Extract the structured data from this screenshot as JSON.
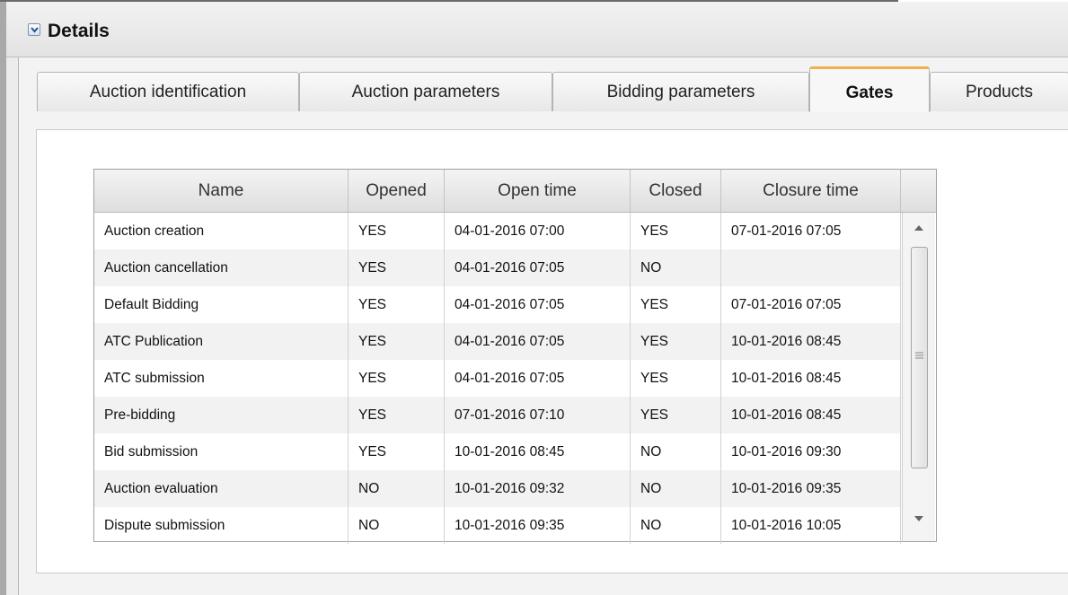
{
  "panel": {
    "title": "Details",
    "collapse_icon": "chevron-down-icon"
  },
  "tabs": [
    {
      "label": "Auction identification",
      "active": false
    },
    {
      "label": "Auction parameters",
      "active": false
    },
    {
      "label": "Bidding parameters",
      "active": false
    },
    {
      "label": "Gates",
      "active": true
    },
    {
      "label": "Products",
      "active": false
    }
  ],
  "table": {
    "columns": [
      "Name",
      "Opened",
      "Open time",
      "Closed",
      "Closure time"
    ],
    "rows": [
      [
        "Auction creation",
        "YES",
        "04-01-2016 07:00",
        "YES",
        "07-01-2016 07:05"
      ],
      [
        "Auction cancellation",
        "YES",
        "04-01-2016 07:05",
        "NO",
        ""
      ],
      [
        "Default Bidding",
        "YES",
        "04-01-2016 07:05",
        "YES",
        "07-01-2016 07:05"
      ],
      [
        "ATC Publication",
        "YES",
        "04-01-2016 07:05",
        "YES",
        "10-01-2016 08:45"
      ],
      [
        "ATC submission",
        "YES",
        "04-01-2016 07:05",
        "YES",
        "10-01-2016 08:45"
      ],
      [
        "Pre-bidding",
        "YES",
        "07-01-2016 07:10",
        "YES",
        "10-01-2016 08:45"
      ],
      [
        "Bid submission",
        "YES",
        "10-01-2016 08:45",
        "NO",
        "10-01-2016 09:30"
      ],
      [
        "Auction evaluation",
        "NO",
        "10-01-2016 09:32",
        "NO",
        "10-01-2016 09:35"
      ],
      [
        "Dispute submission",
        "NO",
        "10-01-2016 09:35",
        "NO",
        "10-01-2016 10:05"
      ]
    ]
  },
  "colors": {
    "active_tab_accent": "#f0b14a",
    "alt_row": "#f2f2f2"
  }
}
